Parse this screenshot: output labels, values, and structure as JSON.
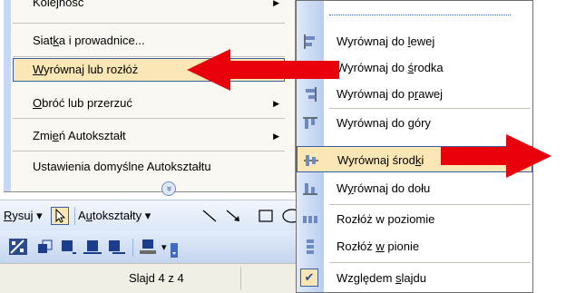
{
  "left_menu": {
    "items": [
      {
        "label_pre": "Kolejność",
        "label_u": "",
        "label_post": "",
        "submenu": true
      },
      {
        "label_pre": "Siat",
        "label_u": "k",
        "label_post": "a i prowadnice...",
        "submenu": false
      },
      {
        "label_pre": "",
        "label_u": "W",
        "label_post": "yrównaj lub rozłóż",
        "submenu": false,
        "selected": true
      },
      {
        "label_pre": "",
        "label_u": "O",
        "label_post": "bróć lub przerzuć",
        "submenu": true
      },
      {
        "label_pre": "Zmi",
        "label_u": "e",
        "label_post": "ń Autokształt",
        "submenu": true
      },
      {
        "label_pre": "Ustawienia domyślne Autokształtu",
        "label_u": "",
        "label_post": "",
        "submenu": false
      }
    ],
    "submenu_glyph": "▶",
    "expand_glyph": "»"
  },
  "draw_toolbar": {
    "draw_label": "Rysuj",
    "draw_u": "R",
    "autoshapes_label": "Autokształty",
    "autoshapes_u": "u",
    "dropdown_glyph": "▾"
  },
  "status_bar": {
    "slide_text": "Slajd 4 z 4"
  },
  "right_menu": {
    "items": [
      {
        "pre": "Wyrównaj do ",
        "u": "l",
        "post": "ewej",
        "icon": "align-left-icon"
      },
      {
        "pre": "Wyrównaj do ",
        "u": "ś",
        "post": "rodka",
        "icon": "align-center-icon"
      },
      {
        "pre": "Wyrównaj do p",
        "u": "r",
        "post": "awej",
        "icon": "align-right-icon"
      },
      {
        "pre": "Wyrównaj do ",
        "u": "g",
        "post": "óry",
        "icon": "align-top-icon"
      },
      {
        "pre": "Wyrównaj środ",
        "u": "k",
        "post": "i",
        "icon": "align-middle-icon",
        "selected": true
      },
      {
        "pre": "W",
        "u": "y",
        "post": "równaj do dołu",
        "icon": "align-bottom-icon"
      },
      {
        "pre": "Rozłóż w poziomie",
        "u": "",
        "post": "",
        "icon": "distribute-horizontal-icon"
      },
      {
        "pre": "Rozłóż ",
        "u": "w",
        "post": " pionie",
        "icon": "distribute-vertical-icon"
      },
      {
        "pre": "Względem ",
        "u": "s",
        "post": "lajdu",
        "icon": "checkmark-icon",
        "checked": true
      }
    ]
  },
  "colors": {
    "arrow": "#e8000b",
    "menu_highlight": "#fbe7b5",
    "highlight_border": "#3c5fa4"
  }
}
